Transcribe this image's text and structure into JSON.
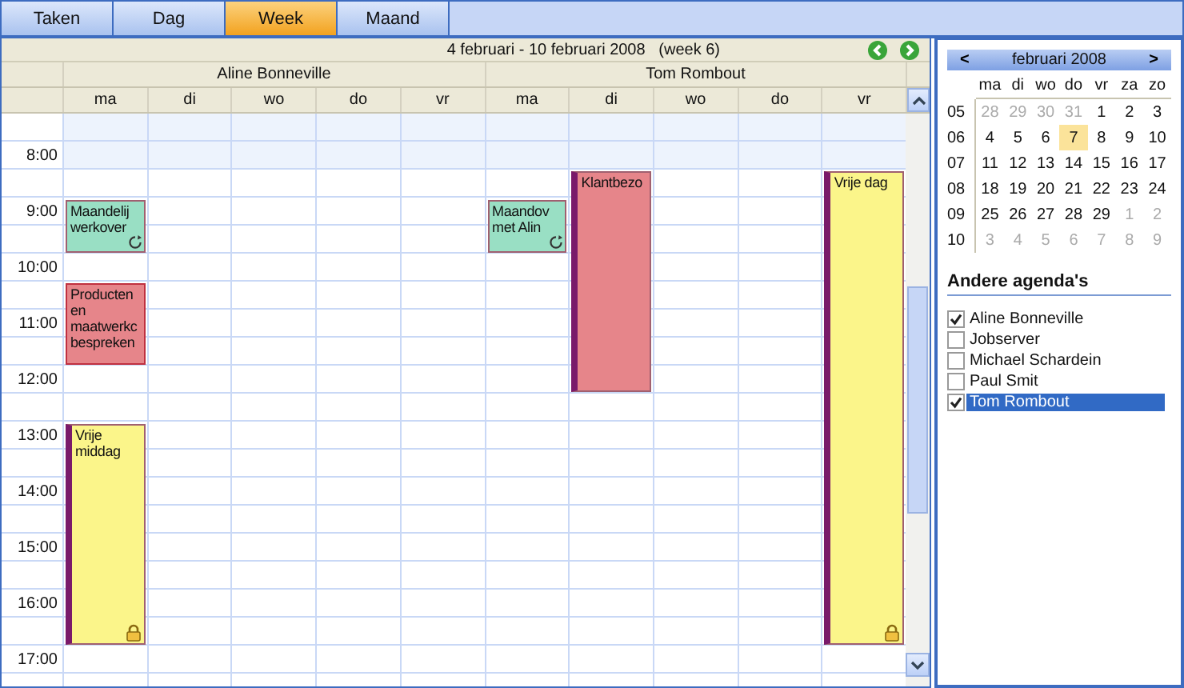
{
  "tabs": [
    {
      "label": "Taken",
      "selected": false
    },
    {
      "label": "Dag",
      "selected": false
    },
    {
      "label": "Week",
      "selected": true
    },
    {
      "label": "Maand",
      "selected": false
    }
  ],
  "calendar": {
    "range_title": "4 februari - 10 februari 2008   (week 6)",
    "hours": [
      "8:00",
      "9:00",
      "10:00",
      "11:00",
      "12:00",
      "13:00",
      "14:00",
      "15:00",
      "16:00",
      "17:00"
    ],
    "people": [
      {
        "name": "Aline Bonneville",
        "days": [
          {
            "label": "ma",
            "events": [
              {
                "text": "Maandelij werkover",
                "color": "#99dfc4",
                "kind": "tentative",
                "recurring": true,
                "locked": false
              },
              {
                "text": "Producten en maatwerkc bespreken",
                "color": "#e6858a",
                "kind": "busy",
                "recurring": false,
                "locked": false
              },
              {
                "text": "Vrije middag",
                "color": "#fbf58a",
                "kind": "away",
                "recurring": false,
                "locked": true
              }
            ]
          },
          {
            "label": "di"
          },
          {
            "label": "wo"
          },
          {
            "label": "do"
          },
          {
            "label": "vr"
          }
        ]
      },
      {
        "name": "Tom Rombout",
        "days": [
          {
            "label": "ma",
            "events": [
              {
                "text": "Maandov met Alin",
                "color": "#99dfc4",
                "kind": "tentative",
                "recurring": true,
                "locked": false
              }
            ]
          },
          {
            "label": "di",
            "events": [
              {
                "text": "Klantbezo",
                "color": "#e6858a",
                "kind": "away",
                "recurring": false,
                "locked": false
              }
            ]
          },
          {
            "label": "wo"
          },
          {
            "label": "do"
          },
          {
            "label": "vr",
            "events": [
              {
                "text": "Vrije dag",
                "color": "#fbf58a",
                "kind": "away",
                "recurring": false,
                "locked": true
              }
            ]
          }
        ]
      }
    ]
  },
  "mini_calendar": {
    "prev": "<",
    "title": "februari 2008",
    "next": ">",
    "weekdays": [
      "ma",
      "di",
      "wo",
      "do",
      "vr",
      "za",
      "zo"
    ],
    "weeks": [
      {
        "number": "05",
        "days": [
          {
            "d": "28",
            "muted": true,
            "selected": false
          },
          {
            "d": "29",
            "muted": true,
            "selected": false
          },
          {
            "d": "30",
            "muted": true,
            "selected": false
          },
          {
            "d": "31",
            "muted": true,
            "selected": false
          },
          {
            "d": "1",
            "muted": false,
            "selected": false
          },
          {
            "d": "2",
            "muted": false,
            "selected": false
          },
          {
            "d": "3",
            "muted": false,
            "selected": false
          }
        ]
      },
      {
        "number": "06",
        "days": [
          {
            "d": "4",
            "muted": false,
            "selected": false
          },
          {
            "d": "5",
            "muted": false,
            "selected": false
          },
          {
            "d": "6",
            "muted": false,
            "selected": false
          },
          {
            "d": "7",
            "muted": false,
            "selected": true
          },
          {
            "d": "8",
            "muted": false,
            "selected": false
          },
          {
            "d": "9",
            "muted": false,
            "selected": false
          },
          {
            "d": "10",
            "muted": false,
            "selected": false
          }
        ]
      },
      {
        "number": "07",
        "days": [
          {
            "d": "11",
            "muted": false,
            "selected": false
          },
          {
            "d": "12",
            "muted": false,
            "selected": false
          },
          {
            "d": "13",
            "muted": false,
            "selected": false
          },
          {
            "d": "14",
            "muted": false,
            "selected": false
          },
          {
            "d": "15",
            "muted": false,
            "selected": false
          },
          {
            "d": "16",
            "muted": false,
            "selected": false
          },
          {
            "d": "17",
            "muted": false,
            "selected": false
          }
        ]
      },
      {
        "number": "08",
        "days": [
          {
            "d": "18",
            "muted": false,
            "selected": false
          },
          {
            "d": "19",
            "muted": false,
            "selected": false
          },
          {
            "d": "20",
            "muted": false,
            "selected": false
          },
          {
            "d": "21",
            "muted": false,
            "selected": false
          },
          {
            "d": "22",
            "muted": false,
            "selected": false
          },
          {
            "d": "23",
            "muted": false,
            "selected": false
          },
          {
            "d": "24",
            "muted": false,
            "selected": false
          }
        ]
      },
      {
        "number": "09",
        "days": [
          {
            "d": "25",
            "muted": false,
            "selected": false
          },
          {
            "d": "26",
            "muted": false,
            "selected": false
          },
          {
            "d": "27",
            "muted": false,
            "selected": false
          },
          {
            "d": "28",
            "muted": false,
            "selected": false
          },
          {
            "d": "29",
            "muted": false,
            "selected": false
          },
          {
            "d": "1",
            "muted": true,
            "selected": false
          },
          {
            "d": "2",
            "muted": true,
            "selected": false
          }
        ]
      },
      {
        "number": "10",
        "days": [
          {
            "d": "3",
            "muted": true,
            "selected": false
          },
          {
            "d": "4",
            "muted": true,
            "selected": false
          },
          {
            "d": "5",
            "muted": true,
            "selected": false
          },
          {
            "d": "6",
            "muted": true,
            "selected": false
          },
          {
            "d": "7",
            "muted": true,
            "selected": false
          },
          {
            "d": "8",
            "muted": true,
            "selected": false
          },
          {
            "d": "9",
            "muted": true,
            "selected": false
          }
        ]
      }
    ]
  },
  "other_calendars": {
    "title": "Andere agenda's",
    "items": [
      {
        "label": "Aline Bonneville",
        "checked": true,
        "selected": false
      },
      {
        "label": "Jobserver",
        "checked": false,
        "selected": false
      },
      {
        "label": "Michael Schardein",
        "checked": false,
        "selected": false
      },
      {
        "label": "Paul Smit",
        "checked": false,
        "selected": false
      },
      {
        "label": "Tom Rombout",
        "checked": true,
        "selected": true
      }
    ]
  }
}
